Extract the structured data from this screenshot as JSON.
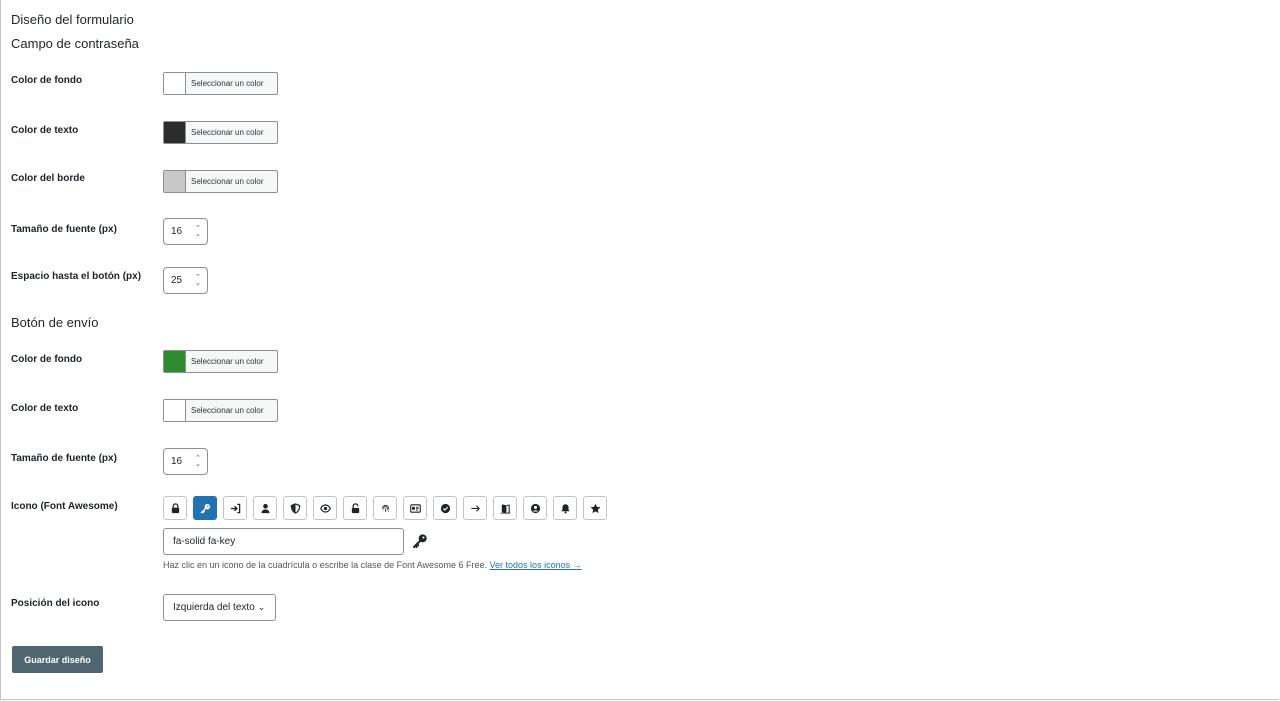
{
  "form": {
    "title": "Diseño del formulario",
    "password_section": {
      "heading": "Campo de contraseña",
      "bg_label": "Color de fondo",
      "bg_color": "#ffffff",
      "text_label": "Color de texto",
      "text_color": "#2c2c2c",
      "border_label": "Color del borde",
      "border_color": "#c8c8c8",
      "font_size_label": "Tamaño de fuente (px)",
      "font_size": "16",
      "spacing_label": "Espacio hasta el botón (px)",
      "spacing": "25"
    },
    "submit_section": {
      "heading": "Botón de envío",
      "bg_label": "Color de fondo",
      "bg_color": "#2e8b2e",
      "text_label": "Color de texto",
      "text_color": "#ffffff",
      "font_size_label": "Tamaño de fuente (px)",
      "font_size": "16",
      "icon_label": "Icono (Font Awesome)",
      "icon_options": [
        "lock",
        "key",
        "right-to-bracket",
        "user",
        "shield-halved",
        "eye",
        "unlock",
        "fingerprint",
        "id-card",
        "circle-check",
        "arrow-right",
        "door-open",
        "circle-user",
        "bell",
        "star"
      ],
      "selected_icon": "key",
      "icon_class_value": "fa-solid fa-key",
      "hint_text": "Haz clic en un icono de la cuadrícula o escribe la clase de Font Awesome 6 Free.",
      "hint_link": "Ver todos los iconos →",
      "position_label": "Posición del icono",
      "position_value": "Izquierda del texto"
    },
    "color_picker_label": "Seleccionar un color",
    "save_button": "Guardar diseño",
    "accent_color": "#2271b1"
  }
}
